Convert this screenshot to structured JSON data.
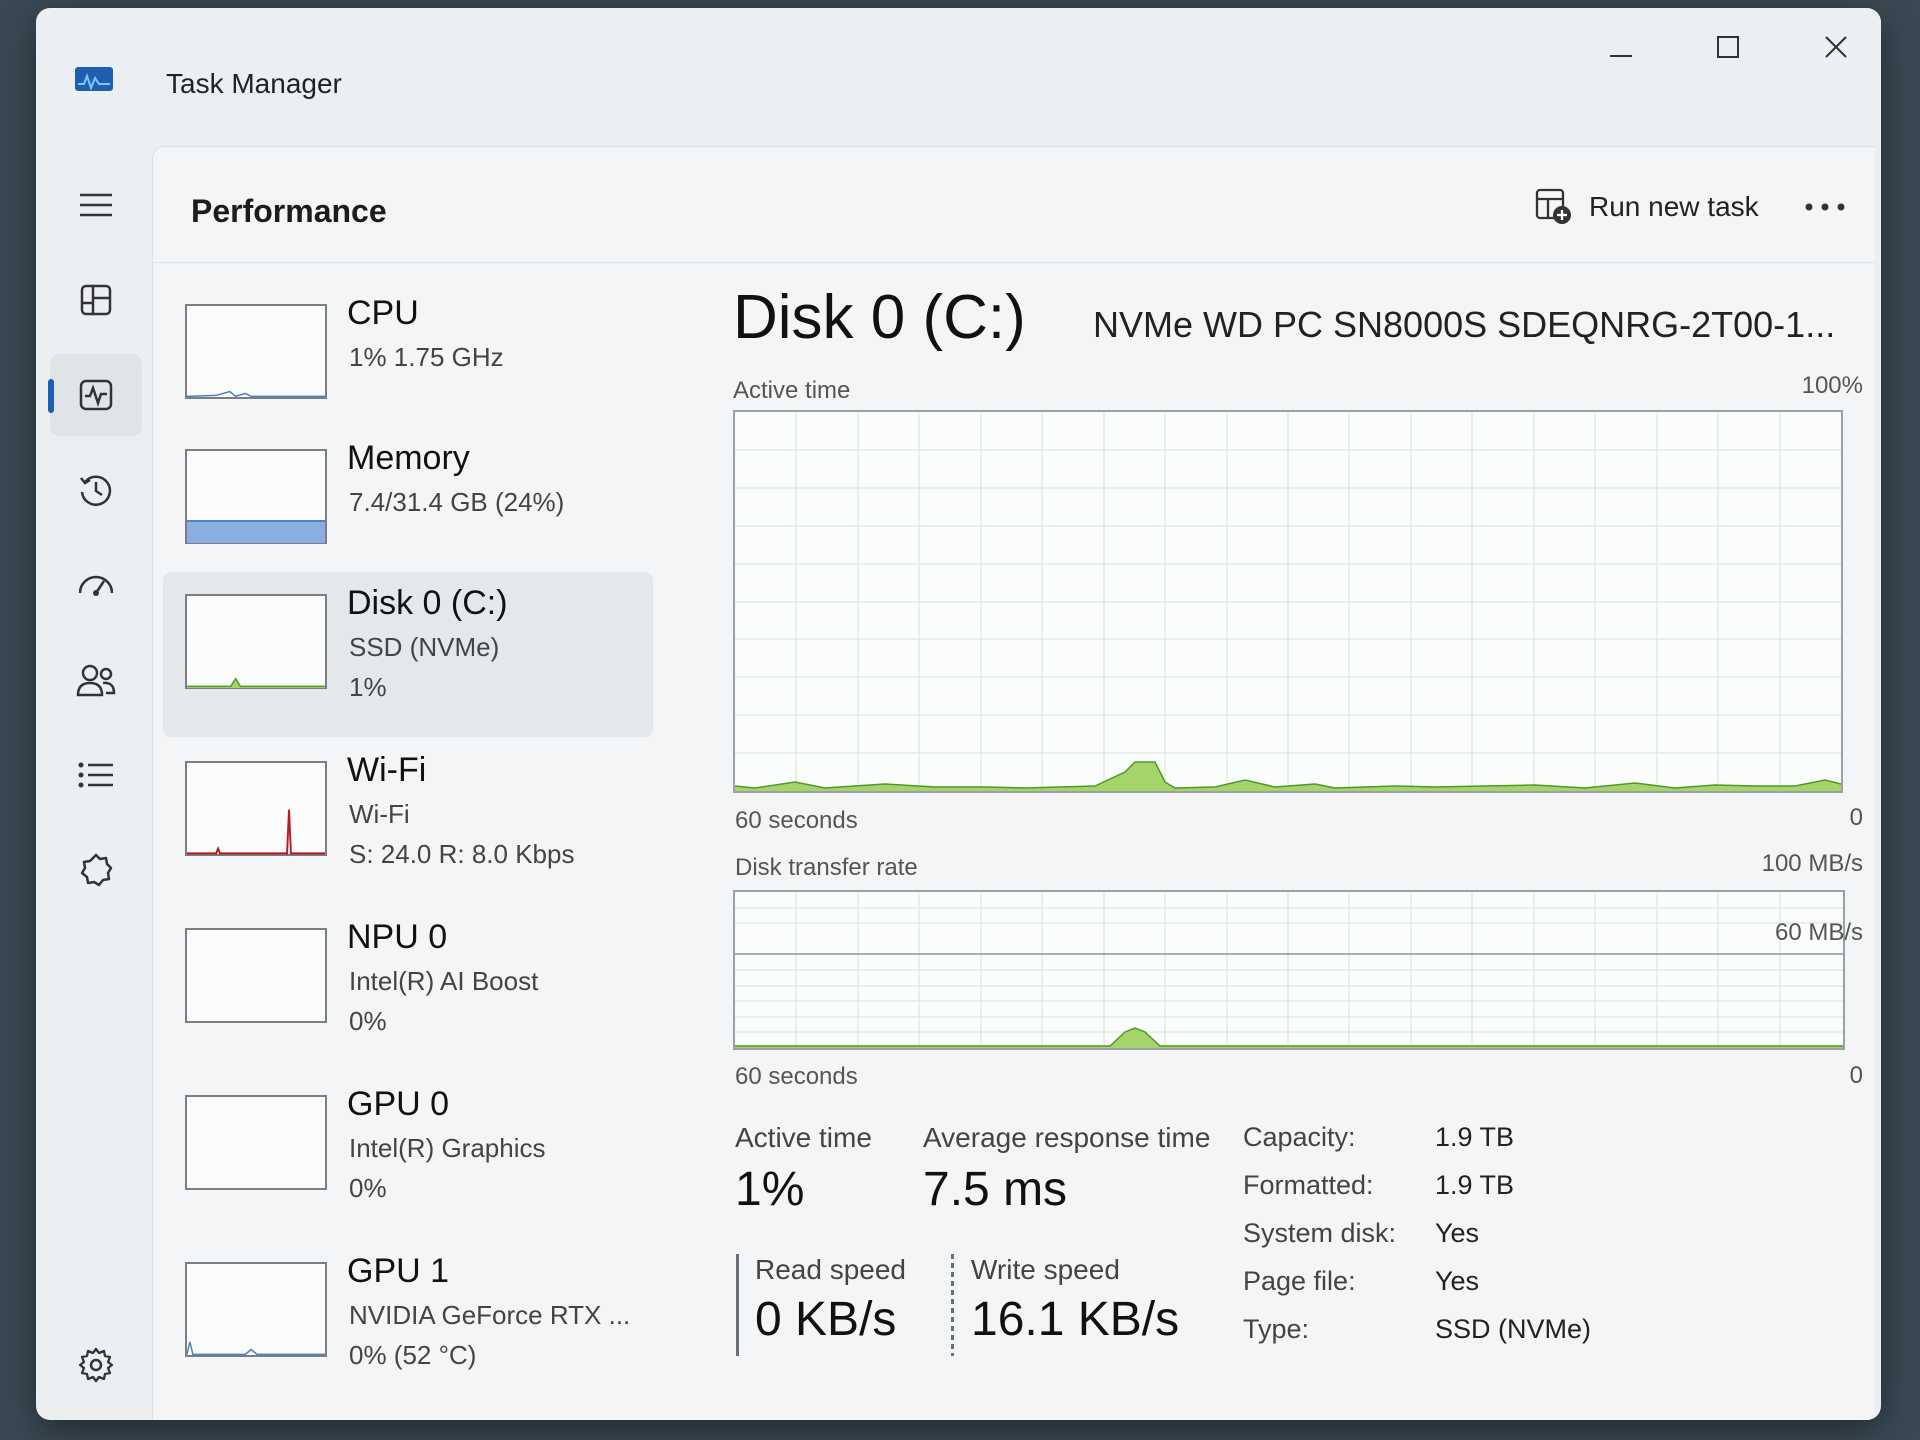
{
  "window": {
    "title": "Task Manager"
  },
  "nav": {
    "items": [
      {
        "name": "menu-icon"
      },
      {
        "name": "processes-icon"
      },
      {
        "name": "performance-icon",
        "active": true
      },
      {
        "name": "app-history-icon"
      },
      {
        "name": "startup-apps-icon"
      },
      {
        "name": "users-icon"
      },
      {
        "name": "details-icon"
      },
      {
        "name": "services-icon"
      },
      {
        "name": "settings-icon"
      }
    ]
  },
  "header": {
    "title": "Performance",
    "run_task_label": "Run new task"
  },
  "resources": [
    {
      "name": "CPU",
      "line1": "1%  1.75 GHz",
      "line2": ""
    },
    {
      "name": "Memory",
      "line1": "7.4/31.4 GB (24%)",
      "line2": ""
    },
    {
      "name": "Disk 0 (C:)",
      "line1": "SSD (NVMe)",
      "line2": "1%",
      "selected": true
    },
    {
      "name": "Wi-Fi",
      "line1": "Wi-Fi",
      "line2": "S: 24.0  R: 8.0 Kbps"
    },
    {
      "name": "NPU 0",
      "line1": "Intel(R) AI Boost",
      "line2": "0%"
    },
    {
      "name": "GPU 0",
      "line1": "Intel(R) Graphics",
      "line2": "0%"
    },
    {
      "name": "GPU 1",
      "line1": "NVIDIA GeForce RTX ...",
      "line2": "0% (52 °C)"
    }
  ],
  "detail": {
    "title": "Disk 0 (C:)",
    "model": "NVMe WD PC SN8000S SDEQNRG-2T00-1...",
    "active_chart": {
      "label": "Active time",
      "max_label": "100%",
      "time_label": "60 seconds",
      "min_label": "0"
    },
    "transfer_chart": {
      "label": "Disk transfer rate",
      "max_label": "100 MB/s",
      "inner_label": "60 MB/s",
      "time_label": "60 seconds",
      "min_label": "0"
    },
    "stats": {
      "active_time_label": "Active time",
      "active_time_value": "1%",
      "avg_response_label": "Average response time",
      "avg_response_value": "7.5 ms",
      "read_label": "Read speed",
      "read_value": "0 KB/s",
      "write_label": "Write speed",
      "write_value": "16.1 KB/s"
    },
    "properties": [
      {
        "key": "Capacity:",
        "value": "1.9 TB"
      },
      {
        "key": "Formatted:",
        "value": "1.9 TB"
      },
      {
        "key": "System disk:",
        "value": "Yes"
      },
      {
        "key": "Page file:",
        "value": "Yes"
      },
      {
        "key": "Type:",
        "value": "SSD (NVMe)"
      }
    ]
  },
  "colors": {
    "disk_fill": "#a5d46a",
    "disk_line": "#4c9a2a",
    "memory_fill": "#8aaee0",
    "wifi_spike": "#b02020",
    "accent": "#1a5fb4"
  }
}
